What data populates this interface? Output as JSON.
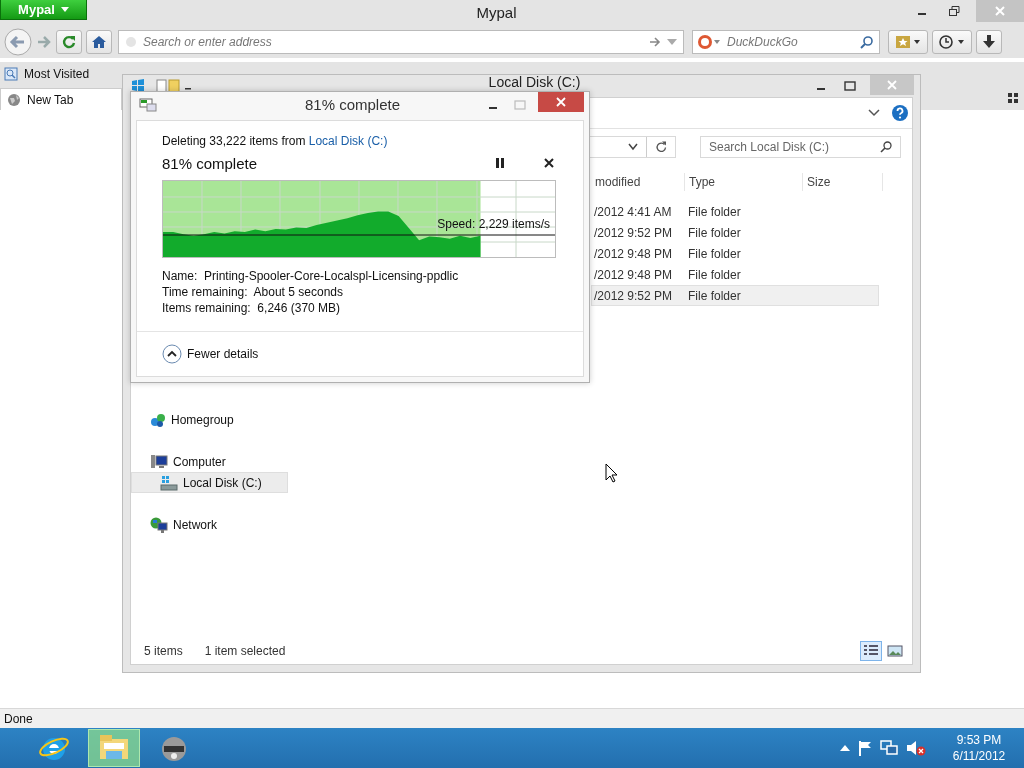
{
  "browser": {
    "menu_button": "Mypal",
    "title": "Mypal",
    "address": {
      "placeholder": "Search or enter address"
    },
    "search": {
      "placeholder": "DuckDuckGo"
    },
    "bookmarks": [
      {
        "label": "Most Visited"
      }
    ],
    "tabs": [
      {
        "label": "New Tab",
        "selected": true
      }
    ],
    "status_bar": "Done"
  },
  "explorer": {
    "title": "Local Disk (C:)",
    "search": {
      "placeholder": "Search Local Disk (C:)"
    },
    "columns": [
      "modified",
      "Type",
      "Size"
    ],
    "rows": [
      {
        "date": "/2012 4:41 AM",
        "type": "File folder",
        "selected": false
      },
      {
        "date": "/2012 9:52 PM",
        "type": "File folder",
        "selected": false
      },
      {
        "date": "/2012 9:48 PM",
        "type": "File folder",
        "selected": false
      },
      {
        "date": "/2012 9:48 PM",
        "type": "File folder",
        "selected": false
      },
      {
        "date": "/2012 9:52 PM",
        "type": "File folder",
        "selected": true
      }
    ],
    "nav": [
      {
        "label": "Homegroup",
        "kind": "homegroup",
        "selected": false
      },
      {
        "label": "Computer",
        "kind": "computer",
        "selected": false,
        "children": [
          {
            "label": "Local Disk (C:)",
            "kind": "drive",
            "selected": true
          }
        ]
      },
      {
        "label": "Network",
        "kind": "network",
        "selected": false
      }
    ],
    "status": [
      "5 items",
      "1 item selected"
    ],
    "views": [
      {
        "kind": "details",
        "selected": true
      },
      {
        "kind": "thumbnails",
        "selected": false
      }
    ]
  },
  "dialog": {
    "title": "81% complete",
    "summary": "Deleting 33,222 items from",
    "source_link": "Local Disk (C:)",
    "heading": "81% complete",
    "level": 0.81,
    "speed": "Speed: 2,229 items/s",
    "details": [
      {
        "label": "Name:",
        "value": "Printing-Spooler-Core-Localspl-Licensing-ppdlic"
      },
      {
        "label": "Time remaining:",
        "value": "About 5 seconds"
      },
      {
        "label": "Items remaining:",
        "value": "6,246 (370 MB)"
      }
    ],
    "toggle": "Fewer details"
  },
  "taskbar": {
    "apps": [
      {
        "kind": "ie",
        "selected": false
      },
      {
        "kind": "explorer",
        "selected": true
      },
      {
        "kind": "mypal",
        "selected": false
      }
    ],
    "time": "9:53 PM",
    "date": "6/11/2012"
  }
}
